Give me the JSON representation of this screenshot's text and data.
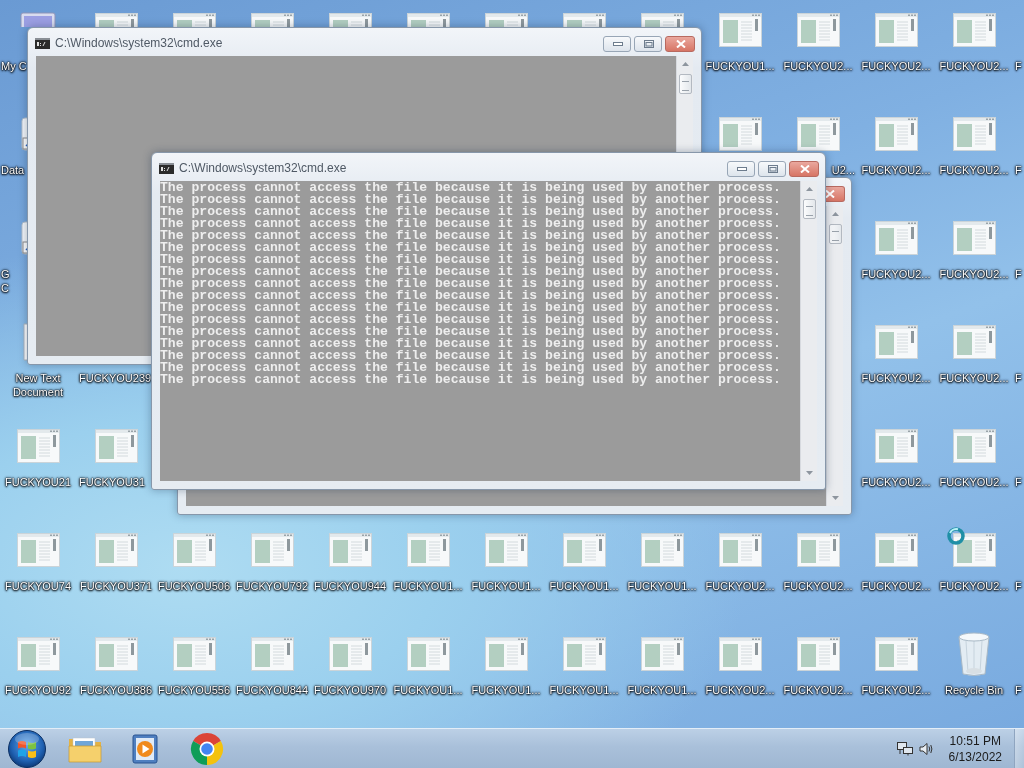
{
  "desktop": {
    "rows": [
      {
        "left": [
          {
            "kind": "computer",
            "label": "My C",
            "clipped_end": true
          },
          {
            "kind": "thumbnail"
          },
          {
            "kind": "thumbnail"
          },
          {
            "kind": "thumbnail"
          },
          {
            "kind": "thumbnail"
          },
          {
            "kind": "thumbnail"
          },
          {
            "kind": "thumbnail"
          },
          {
            "kind": "thumbnail"
          },
          {
            "kind": "thumbnail"
          },
          {
            "kind": "thumbnail",
            "label": "FUCKYOU1..."
          },
          {
            "kind": "thumbnail",
            "label": "FUCKYOU2..."
          },
          {
            "kind": "thumbnail",
            "label": "FUCKYOU2..."
          },
          {
            "kind": "thumbnail",
            "label": "FUCKYOU2..."
          },
          {
            "label": "F",
            "clipped_end": true
          }
        ]
      },
      {
        "left": [
          {
            "kind": "shortcut",
            "label": "Data",
            "clipped_end": true
          }
        ],
        "right": [
          {
            "kind": "thumbnail"
          },
          {
            "kind": "thumbnail",
            "label": "U2...",
            "clipped_start": true
          },
          {
            "kind": "thumbnail",
            "label": "FUCKYOU2..."
          },
          {
            "kind": "thumbnail",
            "label": "FUCKYOU2..."
          },
          {
            "label": "F",
            "clipped_end": true
          }
        ]
      },
      {
        "left": [
          {
            "kind": "shortcut",
            "label": "G\nC",
            "clipped_end": true
          }
        ],
        "right": [
          {
            "kind": "thumbnail",
            "label": "FUCKYOU2..."
          },
          {
            "kind": "thumbnail",
            "label": "FUCKYOU2..."
          },
          {
            "label": "F",
            "clipped_end": true
          }
        ]
      },
      {
        "left": [
          {
            "kind": "text_document",
            "label": "New Text Document"
          },
          {
            "label": "FUCKYOU239",
            "clipped_end": true
          }
        ],
        "right": [
          {
            "kind": "thumbnail",
            "label": "FUCKYOU2..."
          },
          {
            "kind": "thumbnail",
            "label": "FUCKYOU2..."
          },
          {
            "label": "F",
            "clipped_end": true
          }
        ]
      },
      {
        "left": [
          {
            "kind": "thumbnail",
            "label": "FUCKYOU21"
          },
          {
            "kind": "thumbnail",
            "label": "FUCKYOU31",
            "clipped_end": true
          }
        ],
        "right": [
          {
            "kind": "thumbnail",
            "label": "FUCKYOU2..."
          },
          {
            "kind": "thumbnail",
            "label": "FUCKYOU2..."
          },
          {
            "label": "F",
            "clipped_end": true
          }
        ]
      },
      {
        "left": [
          {
            "kind": "thumbnail",
            "label": "FUCKYOU74"
          },
          {
            "kind": "thumbnail",
            "label": "FUCKYOU371"
          },
          {
            "kind": "thumbnail",
            "label": "FUCKYOU506"
          },
          {
            "kind": "thumbnail",
            "label": "FUCKYOU792"
          },
          {
            "kind": "thumbnail",
            "label": "FUCKYOU944"
          },
          {
            "kind": "thumbnail",
            "label": "FUCKYOU1..."
          },
          {
            "kind": "thumbnail",
            "label": "FUCKYOU1..."
          },
          {
            "kind": "thumbnail",
            "label": "FUCKYOU1..."
          },
          {
            "kind": "thumbnail",
            "label": "FUCKYOU1..."
          },
          {
            "kind": "thumbnail",
            "label": "FUCKYOU2..."
          },
          {
            "kind": "thumbnail",
            "label": "FUCKYOU2..."
          },
          {
            "kind": "thumbnail",
            "label": "FUCKYOU2..."
          },
          {
            "kind": "thumbnail",
            "label": "FUCKYOU2..."
          },
          {
            "label": "F",
            "clipped_end": true
          }
        ]
      },
      {
        "left": [
          {
            "kind": "thumbnail",
            "label": "FUCKYOU92"
          },
          {
            "kind": "thumbnail",
            "label": "FUCKYOU386"
          },
          {
            "kind": "thumbnail",
            "label": "FUCKYOU556"
          },
          {
            "kind": "thumbnail",
            "label": "FUCKYOU844"
          },
          {
            "kind": "thumbnail",
            "label": "FUCKYOU970"
          },
          {
            "kind": "thumbnail",
            "label": "FUCKYOU1..."
          },
          {
            "kind": "thumbnail",
            "label": "FUCKYOU1..."
          },
          {
            "kind": "thumbnail",
            "label": "FUCKYOU1..."
          },
          {
            "kind": "thumbnail",
            "label": "FUCKYOU1..."
          },
          {
            "kind": "thumbnail",
            "label": "FUCKYOU2..."
          },
          {
            "kind": "thumbnail",
            "label": "FUCKYOU2..."
          },
          {
            "kind": "thumbnail",
            "label": "FUCKYOU2..."
          },
          {
            "kind": "recycle_bin",
            "label": "Recycle Bin"
          },
          {
            "label": "F",
            "clipped_end": true
          }
        ]
      }
    ]
  },
  "windows": [
    {
      "kind": "console",
      "title": "C:\\Windows\\system32\\cmd.exe"
    },
    {
      "kind": "console"
    },
    {
      "kind": "console",
      "title": "C:\\Windows\\system32\\cmd.exe",
      "lines": [
        "The process cannot access the file because it is being used by another process.",
        "The process cannot access the file because it is being used by another process.",
        "The process cannot access the file because it is being used by another process.",
        "The process cannot access the file because it is being used by another process.",
        "The process cannot access the file because it is being used by another process.",
        "The process cannot access the file because it is being used by another process.",
        "The process cannot access the file because it is being used by another process.",
        "The process cannot access the file because it is being used by another process.",
        "The process cannot access the file because it is being used by another process.",
        "The process cannot access the file because it is being used by another process.",
        "The process cannot access the file because it is being used by another process.",
        "The process cannot access the file because it is being used by another process.",
        "The process cannot access the file because it is being used by another process.",
        "The process cannot access the file because it is being used by another process.",
        "The process cannot access the file because it is being used by another process.",
        "The process cannot access the file because it is being used by another process.",
        "The process cannot access the file because it is being used by another process."
      ]
    }
  ],
  "taskbar": {
    "clock": {
      "time": "10:51 PM",
      "date": "6/13/2022"
    }
  }
}
